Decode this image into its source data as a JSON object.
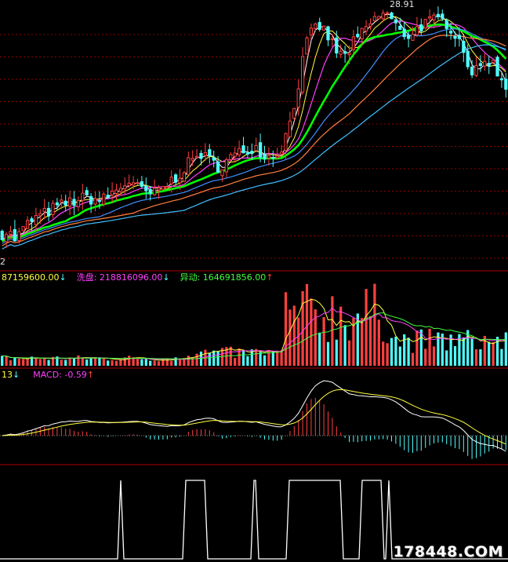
{
  "chart_data": [
    {
      "type": "candlestick",
      "panel": "price",
      "high_label": "28.91",
      "low_label": "2",
      "colors": {
        "up": "#ff4040",
        "down": "#50ffff",
        "ma5": "#ffffff",
        "ma10": "#ffff40",
        "ma20": "#ff40ff",
        "ma30": "#00ff00",
        "ma60": "#4090ff",
        "ma120": "#ff8040",
        "ma250": "#40c0ff"
      },
      "ylim": [
        11.5,
        29.5
      ],
      "price_path": [
        [
          0,
          13.0
        ],
        [
          10,
          13.2
        ],
        [
          20,
          12.6
        ],
        [
          30,
          13.4
        ],
        [
          40,
          14.0
        ],
        [
          55,
          14.4
        ],
        [
          70,
          14.9
        ],
        [
          90,
          15.3
        ],
        [
          110,
          15.6
        ],
        [
          130,
          15.4
        ],
        [
          150,
          16.2
        ],
        [
          165,
          16.8
        ],
        [
          180,
          16.1
        ],
        [
          195,
          15.8
        ],
        [
          210,
          16.4
        ],
        [
          225,
          17.1
        ],
        [
          240,
          18.0
        ],
        [
          255,
          18.8
        ],
        [
          268,
          18.2
        ],
        [
          280,
          17.8
        ],
        [
          295,
          18.5
        ],
        [
          310,
          18.9
        ],
        [
          325,
          19.3
        ],
        [
          340,
          18.5
        ],
        [
          352,
          18.7
        ],
        [
          362,
          19.5
        ],
        [
          372,
          21.5
        ],
        [
          380,
          23.5
        ],
        [
          390,
          26.5
        ],
        [
          398,
          27.4
        ],
        [
          405,
          28.0
        ],
        [
          412,
          27.6
        ],
        [
          420,
          27.0
        ],
        [
          430,
          26.0
        ],
        [
          440,
          25.7
        ],
        [
          450,
          26.6
        ],
        [
          460,
          27.2
        ],
        [
          470,
          27.9
        ],
        [
          480,
          28.4
        ],
        [
          490,
          28.9
        ],
        [
          500,
          28.3
        ],
        [
          510,
          27.4
        ],
        [
          520,
          27.2
        ],
        [
          530,
          27.6
        ],
        [
          540,
          28.0
        ],
        [
          550,
          28.2
        ],
        [
          560,
          28.3
        ],
        [
          570,
          28.1
        ],
        [
          580,
          27.4
        ],
        [
          590,
          26.5
        ],
        [
          600,
          24.6
        ],
        [
          610,
          24.6
        ],
        [
          620,
          25.6
        ],
        [
          630,
          25.1
        ],
        [
          640,
          24.0
        ],
        [
          648,
          23.4
        ]
      ]
    },
    {
      "type": "bar",
      "panel": "volume",
      "legend": [
        {
          "label": "87159600.00",
          "arrow": "↓",
          "color": "#ffff40",
          "arrow_color": "#50ffff"
        },
        {
          "label": "洗盘: 218816096.00",
          "arrow": "↓",
          "color": "#ff40ff",
          "arrow_color": "#50ffff"
        },
        {
          "label": "异动: 164691856.00",
          "arrow": "↑",
          "color": "#40ff40",
          "arrow_color": "#ff4040"
        }
      ],
      "ylim": [
        0,
        1
      ]
    },
    {
      "type": "bar",
      "panel": "macd",
      "legend": [
        {
          "label": "13",
          "arrow": "↓",
          "color": "#ffff40",
          "arrow_color": "#50ffff"
        },
        {
          "label": "MACD: -0.59",
          "arrow": "↑",
          "color": "#ff40ff",
          "arrow_color": "#ff4040"
        }
      ],
      "ylim": [
        -1,
        1
      ]
    },
    {
      "type": "line",
      "panel": "signal",
      "pulses": [
        [
          150,
          158
        ],
        [
          233,
          265
        ],
        [
          320,
          330
        ],
        [
          365,
          438
        ],
        [
          458,
          490
        ],
        [
          492,
          500
        ]
      ],
      "ylim": [
        0,
        1
      ]
    }
  ],
  "watermark": "178448.COM"
}
